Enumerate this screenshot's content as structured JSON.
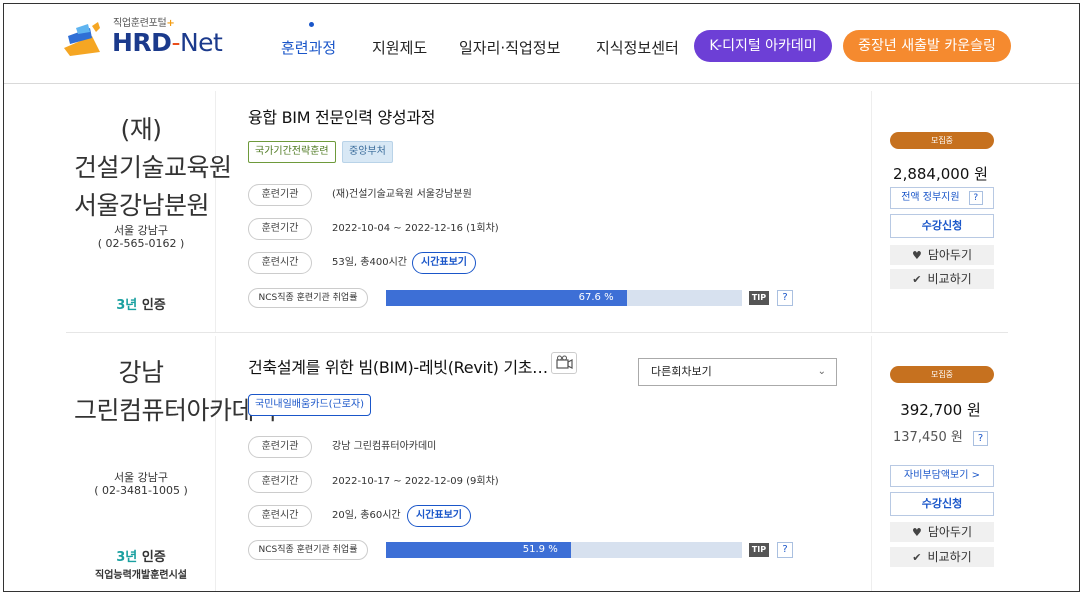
{
  "header": {
    "logo_sub": "직업훈련포털",
    "logo_plus": "+",
    "logo_hrd": "HRD",
    "logo_dash": "-",
    "logo_net": "Net",
    "nav": [
      "훈련과정",
      "지원제도",
      "일자리·직업정보",
      "지식정보센터"
    ],
    "pill_k": "K-디지털 아카데미",
    "pill_s": "중장년 새출발 카운슬링",
    "colors": {
      "primary": "#1a56c9",
      "k_pill": "#6d3fd6",
      "s_pill": "#f58a2f"
    }
  },
  "courses": [
    {
      "institute_name": "(재)건설기술교육원 서울강남분원",
      "address": "서울 강남구",
      "phone": "( 02-565-0162 )",
      "cert_years": "3년",
      "cert_label": "인증",
      "cert_sub": "",
      "title": "융합 BIM 전문인력 양성과정",
      "tags": [
        "국가기간전략훈련",
        "중앙부처"
      ],
      "labels": {
        "org": "훈련기관",
        "period": "훈련기간",
        "hours": "훈련시간",
        "ncs": "NCS직종 훈련기관 취업률"
      },
      "org": "(재)건설기술교육원 서울강남분원",
      "period": "2022-10-04 ~ 2022-12-16 (1회차)",
      "hours": "53일, 총400시간",
      "timetable_button": "시간표보기",
      "employment_rate": "67.6 %",
      "employment_rate_value": 67.6,
      "tip": "TIP",
      "q": "?",
      "status": "모집중",
      "price": "2,884,000 원",
      "support": "전액 정부지원",
      "apply": "수강신청",
      "save": "담아두기",
      "compare": "비교하기"
    },
    {
      "institute_name": "강남 그린컴퓨터아카데미",
      "address": "서울 강남구",
      "phone": "( 02-3481-1005 )",
      "cert_years": "3년",
      "cert_label": "인증",
      "cert_sub": "직업능력개발훈련시설",
      "title": "건축설계를 위한 빔(BIM)-레빗(Revit) 기초…",
      "tags": [
        "국민내일배움카드(근로자)"
      ],
      "other_rounds": "다른회차보기",
      "labels": {
        "org": "훈련기관",
        "period": "훈련기간",
        "hours": "훈련시간",
        "ncs": "NCS직종 훈련기관 취업률"
      },
      "org": "강남 그린컴퓨터아카데미",
      "period": "2022-10-17 ~ 2022-12-09 (9회차)",
      "hours": "20일, 총60시간",
      "timetable_button": "시간표보기",
      "employment_rate": "51.9 %",
      "employment_rate_value": 51.9,
      "tip": "TIP",
      "q": "?",
      "status": "모집중",
      "price": "392,700 원",
      "price_self": "137,450 원",
      "self_pay_button": "자비부담액보기 >",
      "apply": "수강신청",
      "save": "담아두기",
      "compare": "비교하기"
    }
  ]
}
